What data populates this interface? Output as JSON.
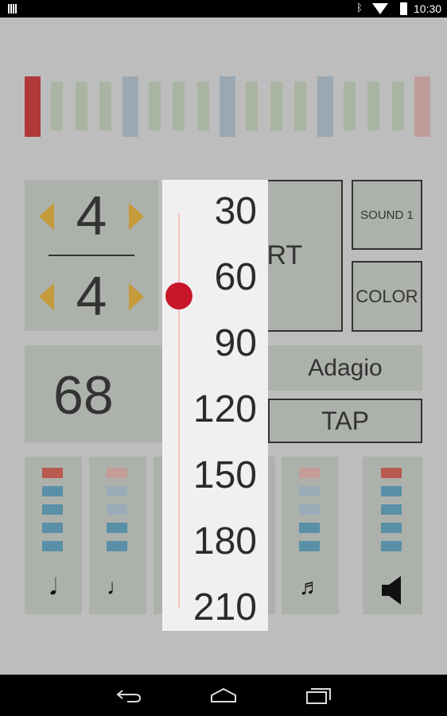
{
  "status_bar": {
    "time": "10:30",
    "icons": [
      "notification-icon",
      "bluetooth-icon",
      "wifi-icon",
      "battery-icon"
    ]
  },
  "beat_bars": [
    {
      "type": "accent",
      "color": "#b03a3a"
    },
    {
      "type": "sub",
      "color": "#a9b5a2"
    },
    {
      "type": "sub",
      "color": "#a9b5a2"
    },
    {
      "type": "sub",
      "color": "#a9b5a2"
    },
    {
      "type": "beat",
      "color": "#9aa8b2"
    },
    {
      "type": "sub",
      "color": "#a9b5a2"
    },
    {
      "type": "sub",
      "color": "#a9b5a2"
    },
    {
      "type": "sub",
      "color": "#a9b5a2"
    },
    {
      "type": "beat",
      "color": "#9aa8b2"
    },
    {
      "type": "sub",
      "color": "#a9b5a2"
    },
    {
      "type": "sub",
      "color": "#a9b5a2"
    },
    {
      "type": "sub",
      "color": "#a9b5a2"
    },
    {
      "type": "beat",
      "color": "#9aa8b2"
    },
    {
      "type": "sub",
      "color": "#a9b5a2"
    },
    {
      "type": "sub",
      "color": "#a9b5a2"
    },
    {
      "type": "sub",
      "color": "#a9b5a2"
    },
    {
      "type": "accent-dim",
      "color": "#c09c98"
    }
  ],
  "time_signature": {
    "numerator": "4",
    "denominator": "4"
  },
  "buttons": {
    "start": "START",
    "sound": "SOUND 1",
    "color": "COLOR",
    "tap": "TAP"
  },
  "tempo": {
    "bpm": "68",
    "marking": "Adagio"
  },
  "colors": {
    "accent": "#c49a3a",
    "knob": "#c8162a",
    "led_red": "#b85a50",
    "led_blue": "#5a8fa8",
    "led_red_dim": "#c49c98",
    "led_blue_dim": "#9aacb8"
  },
  "subdivisions": [
    {
      "icon": "accent-quarter-note-icon",
      "glyph": "𝅘𝅥",
      "levels": [
        "red",
        "blue",
        "blue",
        "blue",
        "blue"
      ]
    },
    {
      "icon": "quarter-note-icon",
      "glyph": "♩",
      "levels": [
        "red_dim",
        "blue_dim",
        "blue_dim",
        "blue",
        "blue"
      ]
    },
    {
      "icon": "hidden",
      "glyph": "",
      "levels": []
    },
    {
      "icon": "hidden",
      "glyph": "",
      "levels": []
    },
    {
      "icon": "sixteenth-notes-icon",
      "glyph": "♬",
      "levels": [
        "red_dim",
        "blue_dim",
        "blue_dim",
        "blue",
        "blue"
      ]
    },
    {
      "icon": "speaker-icon",
      "glyph": "",
      "levels": [
        "red",
        "blue",
        "blue",
        "blue",
        "blue"
      ]
    }
  ],
  "tempo_picker": {
    "values": [
      "30",
      "60",
      "90",
      "120",
      "150",
      "180",
      "210"
    ],
    "selected_fraction": 0.21
  }
}
